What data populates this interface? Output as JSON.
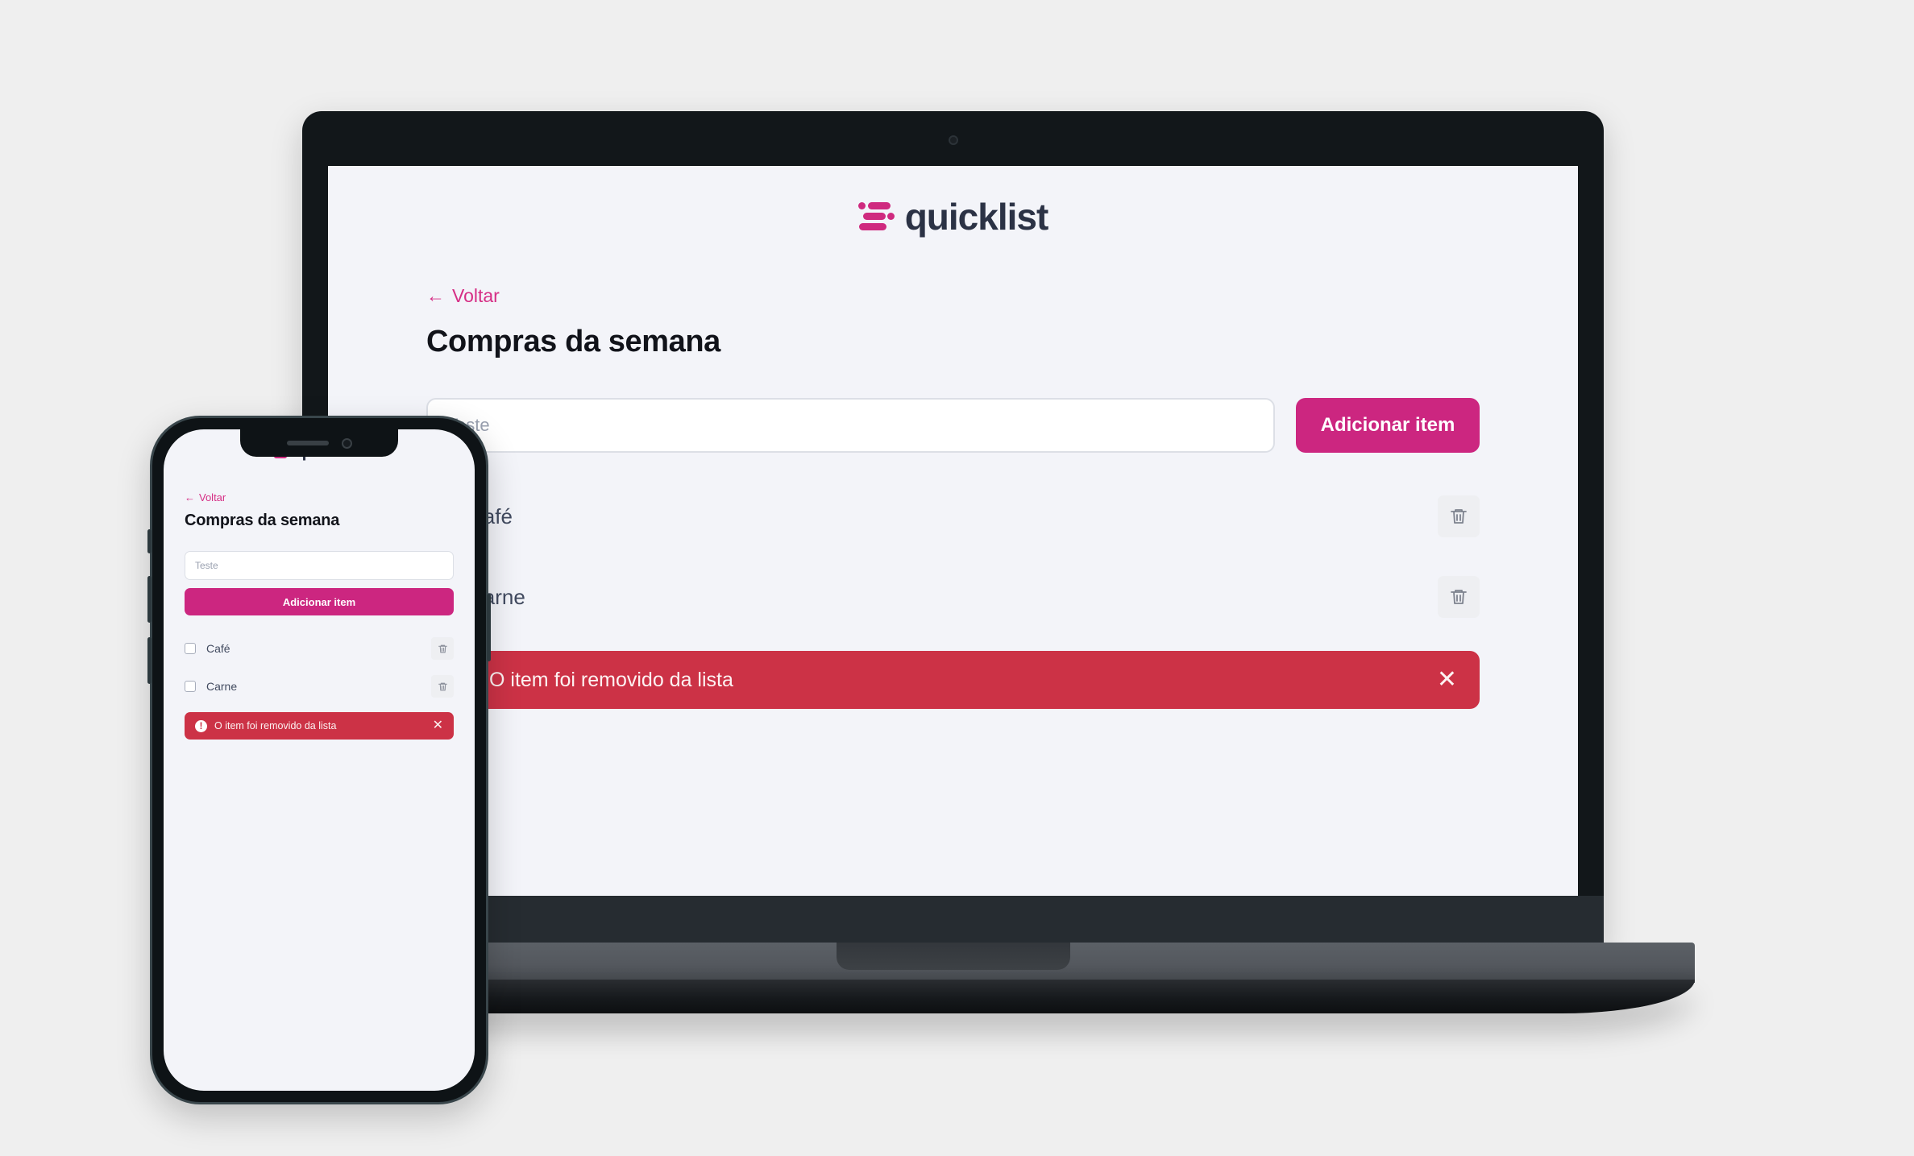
{
  "brand": {
    "name": "quicklist",
    "logo_icon": "quicklist-bars-logo",
    "accent_color": "#cf2a7f"
  },
  "colors": {
    "accent": "#cc2680",
    "link": "#d62e85",
    "alert_bg": "#cc3246",
    "page_bg": "#f3f4f9",
    "title": "#11131a",
    "item_text": "#414a5f"
  },
  "page": {
    "back_label": "Voltar",
    "back_arrow": "←",
    "title": "Compras da semana"
  },
  "add_form": {
    "input_value": "",
    "input_placeholder": "Teste",
    "button_label": "Adicionar item"
  },
  "items": [
    {
      "label": "Café",
      "checked": false,
      "delete_icon": "trash-icon"
    },
    {
      "label": "Carne",
      "checked": false,
      "delete_icon": "trash-icon"
    }
  ],
  "alert": {
    "icon": "exclamation-circle-icon",
    "icon_glyph": "!",
    "message": "O item foi removido da lista",
    "close_glyph": "✕",
    "severity": "error"
  },
  "devices": {
    "laptop": {
      "camera_icon": "webcam-icon"
    },
    "phone": {
      "speaker_icon": "earpiece-speaker",
      "camera_icon": "front-camera-icon"
    }
  }
}
